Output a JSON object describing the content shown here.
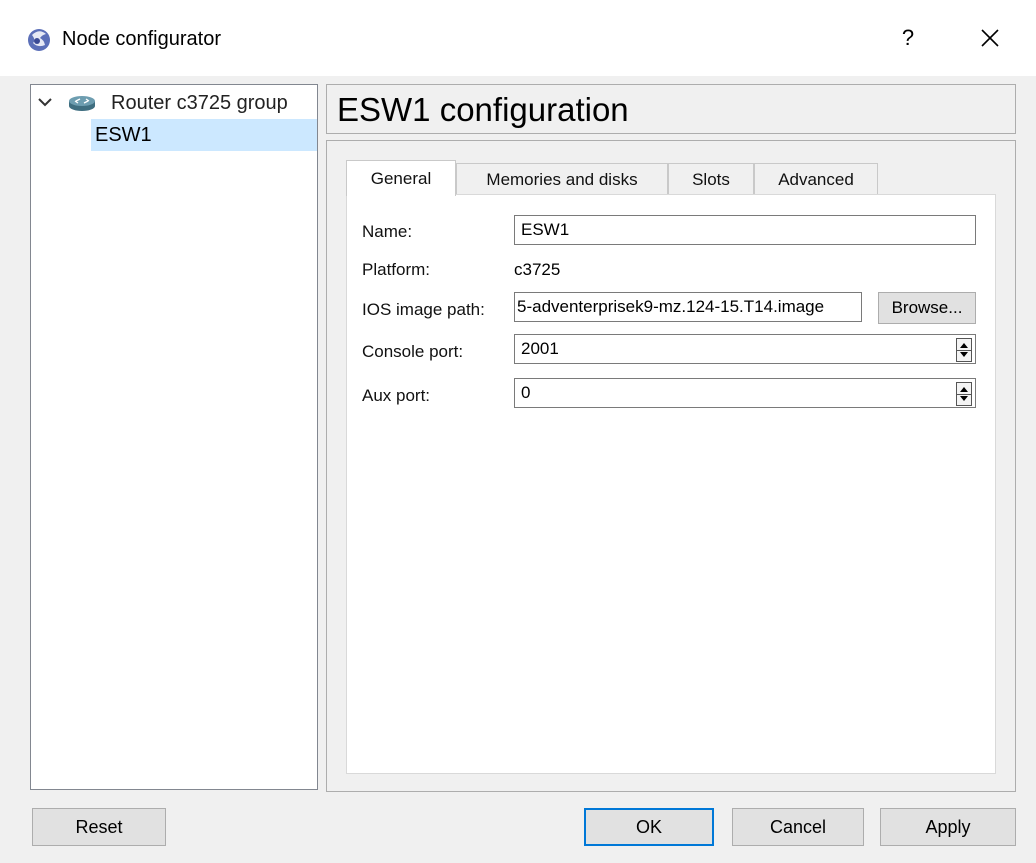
{
  "window": {
    "title": "Node configurator",
    "help_label": "?",
    "close_icon": "close-icon",
    "app_icon": "gns3-app-icon"
  },
  "tree": {
    "expand_icon": "chevron-down-icon",
    "group_icon": "router-icon",
    "group_label": "Router c3725 group",
    "items": [
      {
        "label": "ESW1",
        "selected": true
      }
    ]
  },
  "header": {
    "title": "ESW1 configuration"
  },
  "tabs": [
    {
      "label": "General",
      "active": true
    },
    {
      "label": "Memories and disks",
      "active": false
    },
    {
      "label": "Slots",
      "active": false
    },
    {
      "label": "Advanced",
      "active": false
    }
  ],
  "general": {
    "name_label": "Name:",
    "name_value": "ESW1",
    "platform_label": "Platform:",
    "platform_value": "c3725",
    "ios_label": "IOS image path:",
    "ios_value": "5-adventerprisek9-mz.124-15.T14.image",
    "browse_label": "Browse...",
    "console_label": "Console port:",
    "console_value": "2001",
    "aux_label": "Aux port:",
    "aux_value": "0"
  },
  "footer": {
    "reset_label": "Reset",
    "ok_label": "OK",
    "cancel_label": "Cancel",
    "apply_label": "Apply"
  },
  "colors": {
    "selection": "#cce8ff",
    "default_button_border": "#0078d7",
    "window_background": "#f0f0f0"
  }
}
